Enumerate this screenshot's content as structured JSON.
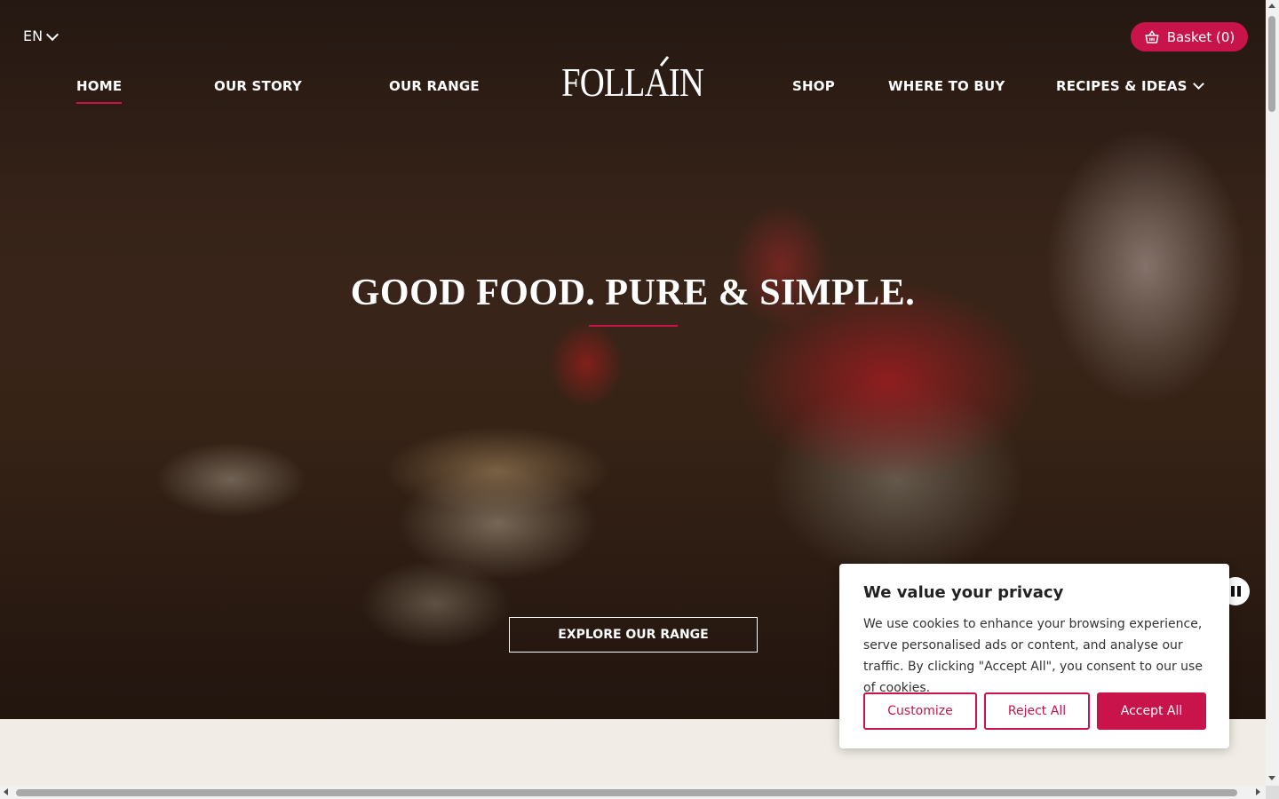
{
  "header": {
    "language": "EN",
    "basket_label": "Basket (0)",
    "logo_text": "Follain"
  },
  "nav": {
    "items": [
      {
        "label": "HOME",
        "active": true
      },
      {
        "label": "OUR STORY"
      },
      {
        "label": "OUR RANGE"
      },
      {
        "label": "SHOP"
      },
      {
        "label": "WHERE TO BUY"
      },
      {
        "label": "RECIPES & IDEAS",
        "has_dropdown": true
      }
    ]
  },
  "hero": {
    "headline": "GOOD FOOD. PURE & SIMPLE.",
    "cta_label": "EXPLORE OUR RANGE"
  },
  "cookie_banner": {
    "title": "We value your privacy",
    "body": "We use cookies to enhance your browsing experience, serve personalised ads or content, and analyse our traffic. By clicking \"Accept All\", you consent to our use of cookies.",
    "customize_label": "Customize",
    "reject_label": "Reject All",
    "accept_label": "Accept All"
  },
  "colors": {
    "accent": "#c8144a",
    "hero_text": "#ffffff"
  }
}
